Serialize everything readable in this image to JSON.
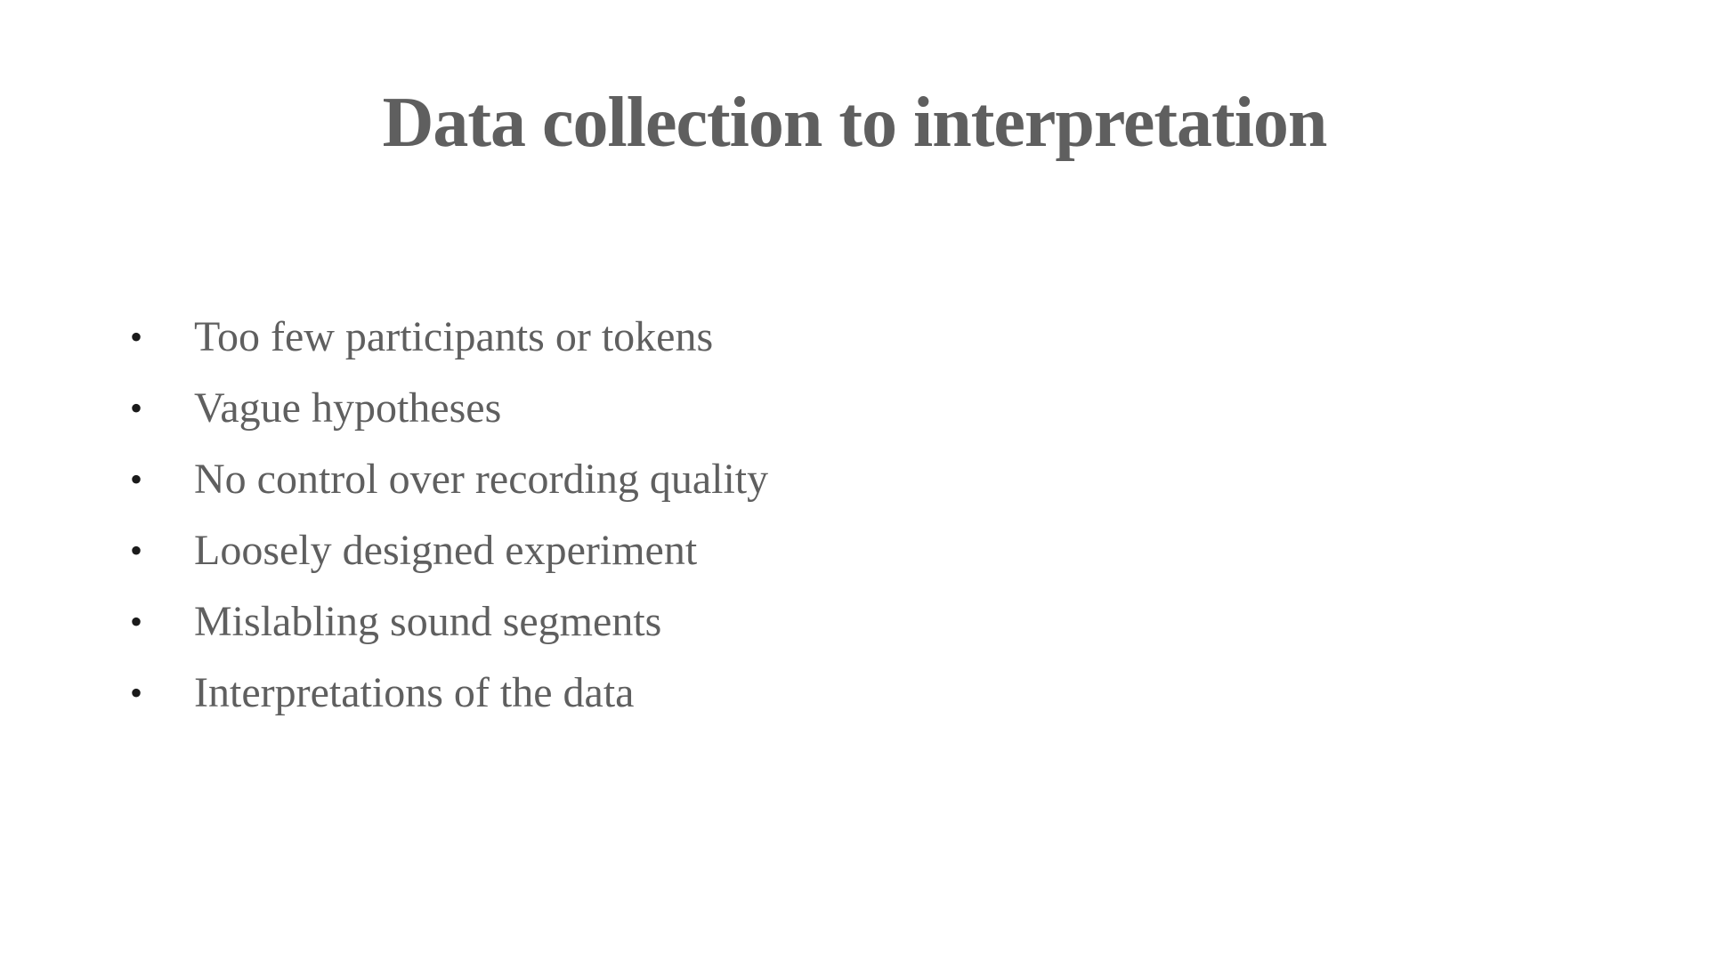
{
  "slide": {
    "title": "Data collection to interpretation",
    "bullet_symbol": "•",
    "bullets": [
      "Too few participants or tokens",
      "Vague hypotheses",
      "No control over recording quality",
      "Loosely designed experiment",
      "Mislabling sound segments",
      "Interpretations of the data"
    ]
  },
  "colors": {
    "background": "#ffffff",
    "text": "#5f5f5f",
    "bullet": "#1a1a1a"
  }
}
